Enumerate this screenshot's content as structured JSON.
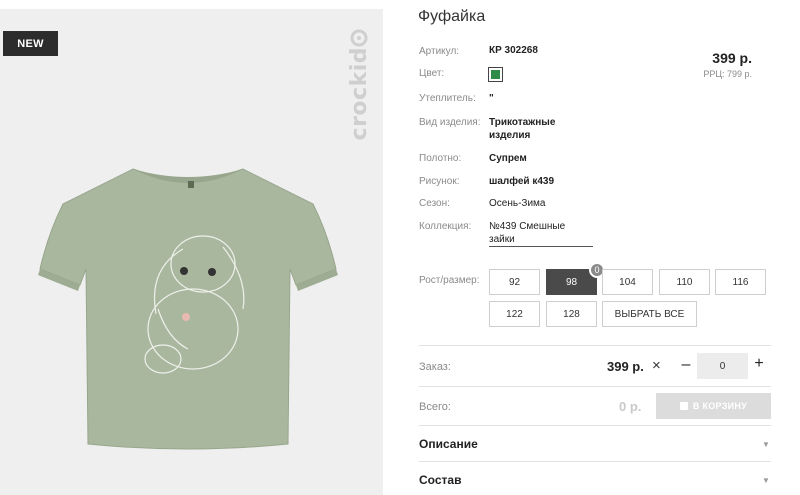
{
  "product": {
    "badge": "NEW",
    "brand": "crockid",
    "title": "Фуфайка",
    "price": "399 р.",
    "rrc": "РРЦ: 799 р.",
    "color_hex": "#2e8b48"
  },
  "props": {
    "article": {
      "label": "Артикул:",
      "value": "КР 302268"
    },
    "color": {
      "label": "Цвет:"
    },
    "insulation": {
      "label": "Утеплитель:",
      "value": "\""
    },
    "type": {
      "label": "Вид изделия:",
      "value_line1": "Трикотажные",
      "value_line2": "изделия"
    },
    "fabric": {
      "label": "Полотно:",
      "value": "Супрем"
    },
    "pattern": {
      "label": "Рисунок:",
      "value": "шалфей к439"
    },
    "season": {
      "label": "Сезон:",
      "value": "Осень-Зима"
    },
    "collection": {
      "label": "Коллекция:",
      "value_line1": "№439 Смешные",
      "value_line2": "зайки"
    }
  },
  "sizes": {
    "label": "Рост/размер:",
    "options": [
      "92",
      "98",
      "104",
      "110",
      "116",
      "122",
      "128"
    ],
    "selected": "98",
    "selected_count": "0",
    "select_all": "ВЫБРАТЬ ВСЕ"
  },
  "order": {
    "label": "Заказ:",
    "price": "399 р.",
    "times": "×",
    "minus": "–",
    "quantity": "0",
    "plus": "+"
  },
  "total": {
    "label": "Всего:",
    "value": "0 р.",
    "cart_label": "В КОРЗИНУ"
  },
  "accordion": {
    "description": "Описание",
    "composition": "Состав"
  }
}
